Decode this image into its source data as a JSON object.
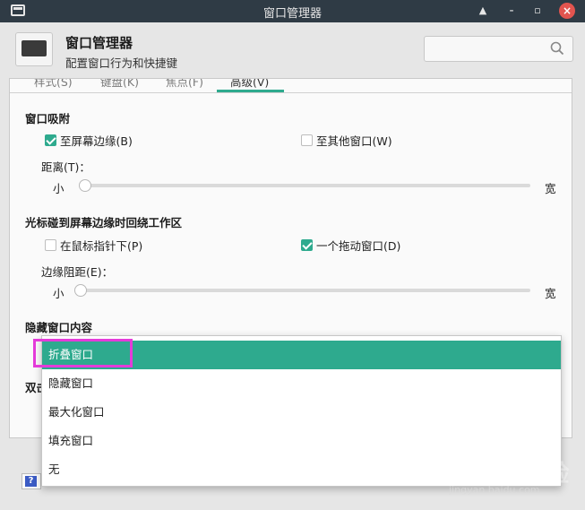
{
  "titlebar": {
    "title": "窗口管理器"
  },
  "header": {
    "title": "窗口管理器",
    "subtitle": "配置窗口行为和快捷键",
    "search": {
      "placeholder": ""
    }
  },
  "tabs": [
    {
      "label": "样式(S)",
      "active": false
    },
    {
      "label": "键盘(K)",
      "active": false
    },
    {
      "label": "焦点(F)",
      "active": false
    },
    {
      "label": "高级(V)",
      "active": true
    }
  ],
  "snap": {
    "title": "窗口吸附",
    "to_screen_edge": {
      "label": "至屏幕边缘(B)",
      "checked": true
    },
    "to_other_windows": {
      "label": "至其他窗口(W)",
      "checked": false
    },
    "distance_label": "距离(T)：",
    "small": "小",
    "wide": "宽",
    "distance_value": 0.0
  },
  "wrap": {
    "title": "光标碰到屏幕边缘时回绕工作区",
    "under_pointer": {
      "label": "在鼠标指针下(P)",
      "checked": false
    },
    "dragging_window": {
      "label": "一个拖动窗口(D)",
      "checked": true
    },
    "resistance_label": "边缘阻距(E)：",
    "small": "小",
    "wide": "宽",
    "resistance_value": 0.0
  },
  "hide_content": {
    "title": "隐藏窗口内容"
  },
  "partial_section_prefix": "双击",
  "dropdown": {
    "options": [
      "折叠窗口",
      "隐藏窗口",
      "最大化窗口",
      "填充窗口",
      "无"
    ],
    "selected_index": 0
  },
  "watermark": {
    "logo": "Baidu经验",
    "url": "jingyan.baidu.com"
  },
  "colors": {
    "accent": "#2eaa8e",
    "highlight": "#e43bd9",
    "titlebar": "#2f3b45"
  }
}
